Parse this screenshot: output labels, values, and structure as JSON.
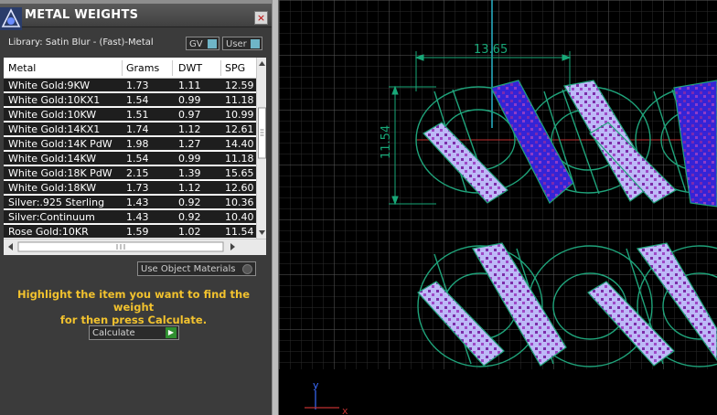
{
  "panel": {
    "title": "METAL WEIGHTS",
    "close_glyph": "×",
    "library_label": "Library: Satin Blur - (Fast)-Metal",
    "toggle_gv": "GV",
    "toggle_user": "User"
  },
  "table": {
    "headers": [
      "Metal",
      "Grams",
      "DWT",
      "SPG"
    ],
    "rows": [
      {
        "metal": "White Gold:9KW",
        "grams": "1.73",
        "dwt": "1.11",
        "spg": "12.59"
      },
      {
        "metal": "White Gold:10KX1",
        "grams": "1.54",
        "dwt": "0.99",
        "spg": "11.18"
      },
      {
        "metal": "White Gold:10KW",
        "grams": "1.51",
        "dwt": "0.97",
        "spg": "10.99"
      },
      {
        "metal": "White Gold:14KX1",
        "grams": "1.74",
        "dwt": "1.12",
        "spg": "12.61"
      },
      {
        "metal": "White Gold:14K PdW",
        "grams": "1.98",
        "dwt": "1.27",
        "spg": "14.40"
      },
      {
        "metal": "White Gold:14KW",
        "grams": "1.54",
        "dwt": "0.99",
        "spg": "11.18"
      },
      {
        "metal": "White Gold:18K PdW",
        "grams": "2.15",
        "dwt": "1.39",
        "spg": "15.65"
      },
      {
        "metal": "White Gold:18KW",
        "grams": "1.73",
        "dwt": "1.12",
        "spg": "12.60"
      },
      {
        "metal": "Silver:.925 Sterling",
        "grams": "1.43",
        "dwt": "0.92",
        "spg": "10.36"
      },
      {
        "metal": "Silver:Continuum",
        "grams": "1.43",
        "dwt": "0.92",
        "spg": "10.40"
      },
      {
        "metal": "Rose Gold:10KR",
        "grams": "1.59",
        "dwt": "1.02",
        "spg": "11.54"
      }
    ]
  },
  "controls": {
    "use_object_materials": "Use Object Materials",
    "instruction_line1": "Highlight the item you want to find the weight",
    "instruction_line2": "for then press Calculate.",
    "calculate_label": "Calculate"
  },
  "viewport": {
    "dim_width": "13.65",
    "dim_height": "11.54",
    "axis_y": "y",
    "axis_x": "x"
  },
  "icons": {
    "app": "app-logo-icon",
    "close": "close-icon",
    "calculate": "play-arrow-icon"
  },
  "colors": {
    "accent_text": "#f2c22e",
    "wire": "#1fa37a",
    "gem_dark": "#3a2ad8",
    "gem_light": "#b9b6f5",
    "dimension": "#18a878"
  }
}
